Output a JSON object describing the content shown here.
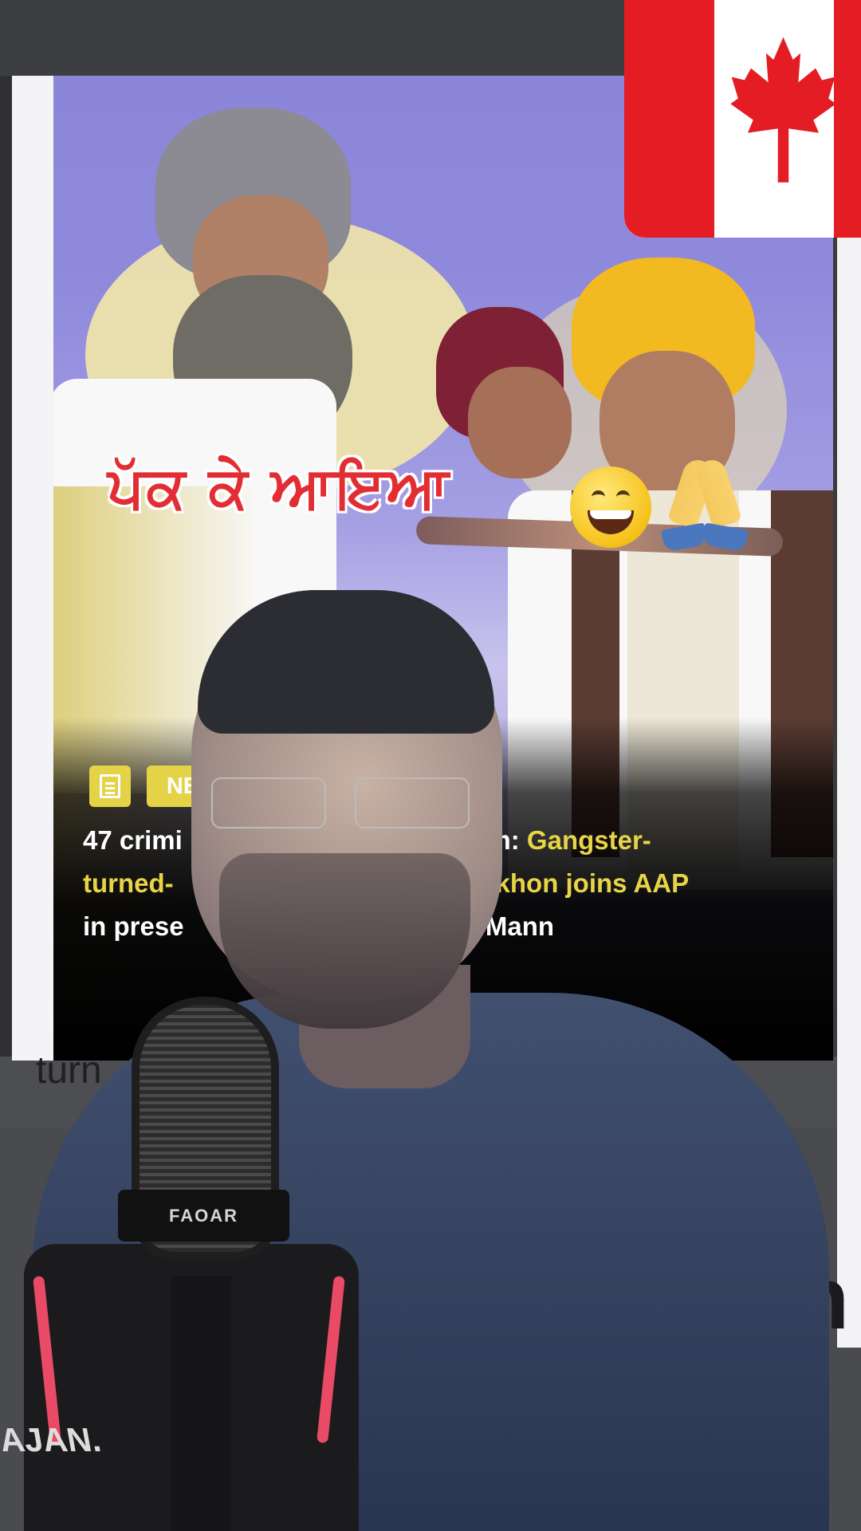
{
  "caption": {
    "punjabi_text": "ਪੱਕ ਕੇ ਆਇਆ",
    "emojis": [
      "grinning-face",
      "folded-hands"
    ]
  },
  "news_card": {
    "badge_label": "NE",
    "headline_part1": "47 crimi",
    "headline_part2": "him: ",
    "headline_highlight1": "Gangster-",
    "headline_line2_start": "turned-",
    "headline_highlight2": "t Sekhon joins AAP",
    "headline_line3_start": "in prese",
    "headline_line3_end": "Mann",
    "colors": {
      "accent": "#e8d547",
      "overlay": "#000000"
    }
  },
  "overlay_flag": {
    "name": "Canada",
    "icon": "canada-flag-icon",
    "colors": {
      "red": "#e41d24",
      "white": "#ffffff"
    }
  },
  "microphone": {
    "brand": "FAOAR"
  },
  "peeking_text": {
    "top_left": "turn",
    "bottom_right": "n",
    "mount_label": "AJAN."
  }
}
